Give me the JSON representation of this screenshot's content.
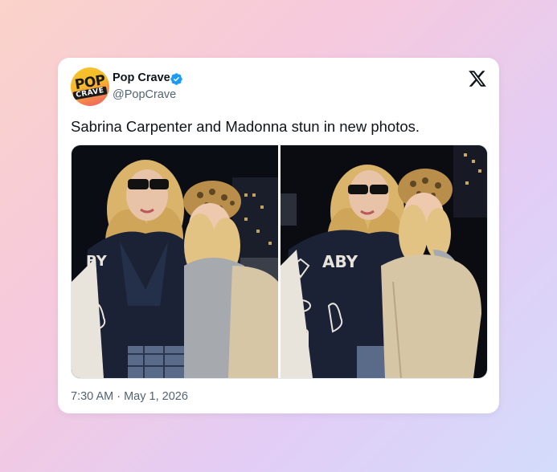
{
  "tweet": {
    "author_name": "Pop Crave",
    "author_handle": "@PopCrave",
    "avatar_text_top": "POP",
    "avatar_text_bottom": "CRAVE",
    "verified": true,
    "text": "Sabrina Carpenter and Madonna stun in new photos.",
    "timestamp": "7:30 AM · May 1, 2026",
    "media_count": 2
  },
  "icons": {
    "verified": "verified-badge-icon",
    "platform": "x-logo-icon"
  },
  "colors": {
    "accent_blue": "#1d9bf0",
    "text_primary": "#0f1419",
    "text_secondary": "#536471"
  }
}
